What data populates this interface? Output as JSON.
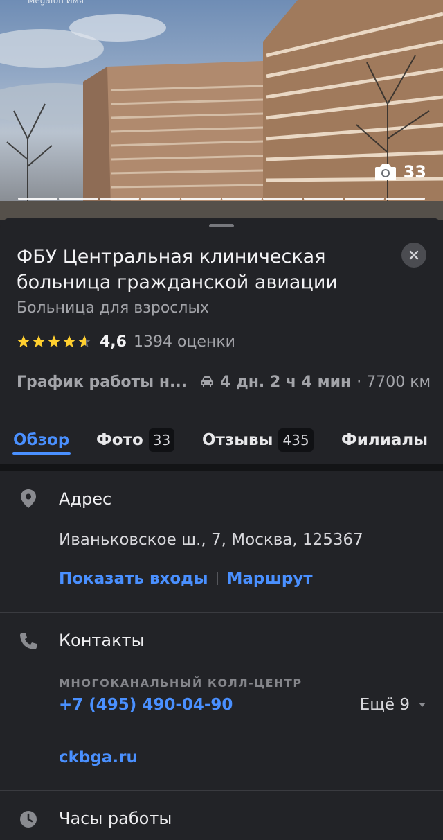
{
  "photo": {
    "credit": "Мegafon Имя",
    "count": "33",
    "progress_segments": 10
  },
  "sheet": {
    "title": "ФБУ Центральная клиническая больница гражданской авиации",
    "category": "Больница для взрослых",
    "rating": {
      "stars": 4.6,
      "value": "4,6",
      "count": "1394 оценки"
    },
    "hours_status": "График работы н...",
    "travel_time": "4 дн. 2 ч 4 мин",
    "travel_distance": "· 7700 км",
    "colors": {
      "accent": "#4a90ff",
      "background": "#222327",
      "star": "#ffcf2f"
    }
  },
  "tabs": [
    {
      "label": "Обзор",
      "badge": ""
    },
    {
      "label": "Фото",
      "badge": "33"
    },
    {
      "label": "Отзывы",
      "badge": "435"
    },
    {
      "label": "Филиалы",
      "badge": ""
    }
  ],
  "address": {
    "title": "Адрес",
    "text": "Иваньковское ш., 7, Москва, 125367",
    "show_entrances": "Показать входы",
    "route": "Маршрут"
  },
  "contacts": {
    "title": "Контакты",
    "phone_caption": "МНОГОКАНАЛЬНЫЙ КОЛЛ-ЦЕНТР",
    "phone": "+7 (495) 490-04-90",
    "more": "Ещё 9",
    "website": "ckbga.ru"
  },
  "hours": {
    "title": "Часы работы"
  },
  "icons": {
    "close": "close-icon",
    "camera": "camera-icon",
    "car": "car-icon",
    "address": "location-pin-icon",
    "contacts": "phone-icon",
    "hours": "clock-icon"
  }
}
